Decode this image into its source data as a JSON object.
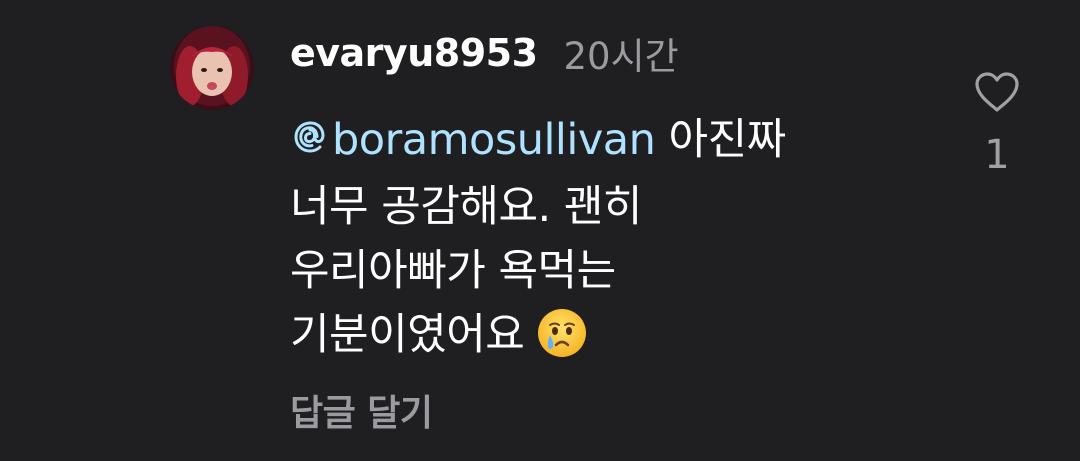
{
  "comment": {
    "username": "evaryu8953",
    "time": "20시간",
    "mention": "boramosullivan",
    "lines": [
      "아진짜",
      "너무 공감해요. 괜히",
      "우리아빠가 욕먹는",
      "기분이였어요"
    ],
    "emoji": "crying-face",
    "reply_label": "답글 달기",
    "like_count": "1"
  },
  "colors": {
    "background": "#1f1f22",
    "text": "#ffffff",
    "secondary": "#9a9aa0",
    "mention": "#aee2ff"
  },
  "icons": {
    "mention": "threads-at-icon",
    "like": "heart-outline-icon"
  }
}
